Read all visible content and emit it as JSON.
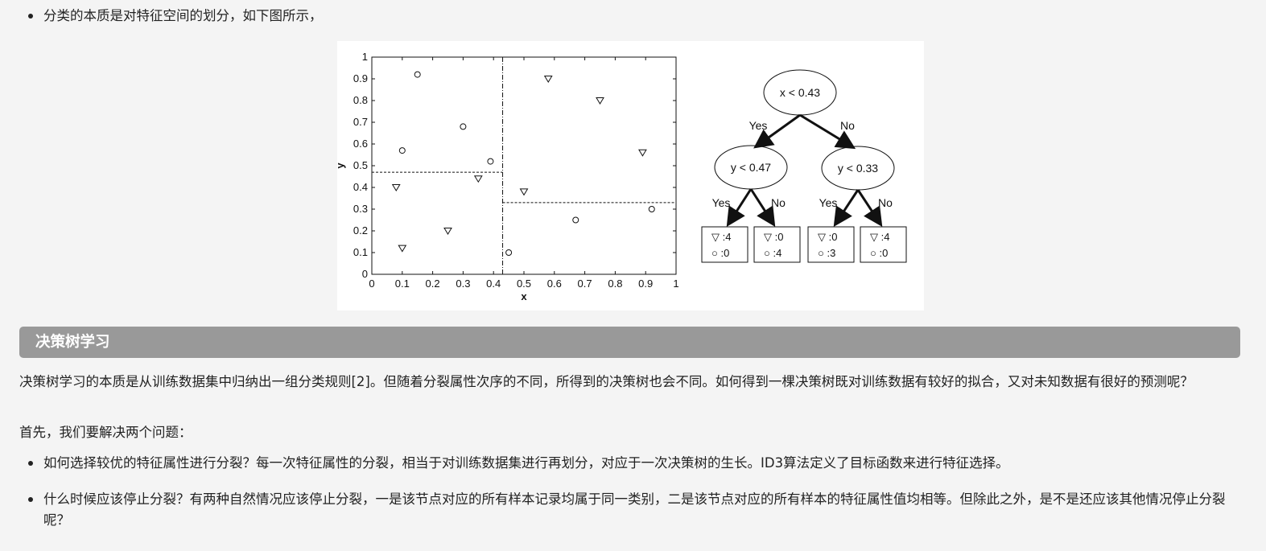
{
  "intro_bullet": "分类的本质是对特征空间的划分，如下图所示，",
  "figure": {
    "plot": {
      "xlabel": "x",
      "ylabel": "y",
      "x_ticks": [
        "0",
        "0.1",
        "0.2",
        "0.3",
        "0.4",
        "0.5",
        "0.6",
        "0.7",
        "0.8",
        "0.9",
        "1"
      ],
      "y_ticks": [
        "0",
        "0.1",
        "0.2",
        "0.3",
        "0.4",
        "0.5",
        "0.6",
        "0.7",
        "0.8",
        "0.9",
        "1"
      ]
    },
    "tree": {
      "root": {
        "label": "x < 0.43"
      },
      "left": {
        "label": "y < 0.47"
      },
      "right": {
        "label": "y < 0.33"
      },
      "yes": "Yes",
      "no": "No",
      "leaves": [
        {
          "tri": "▽ :4",
          "circ": "○ :0"
        },
        {
          "tri": "▽ :0",
          "circ": "○ :4"
        },
        {
          "tri": "▽ :0",
          "circ": "○ :3"
        },
        {
          "tri": "▽ :4",
          "circ": "○ :0"
        }
      ]
    }
  },
  "chart_data": {
    "type": "scatter",
    "xlabel": "x",
    "ylabel": "y",
    "xlim": [
      0,
      1
    ],
    "ylim": [
      0,
      1
    ],
    "series": [
      {
        "marker": "circle",
        "points": [
          [
            0.15,
            0.92
          ],
          [
            0.1,
            0.57
          ],
          [
            0.3,
            0.68
          ],
          [
            0.39,
            0.52
          ],
          [
            0.45,
            0.1
          ],
          [
            0.67,
            0.25
          ],
          [
            0.92,
            0.3
          ]
        ]
      },
      {
        "marker": "triangle-down",
        "points": [
          [
            0.08,
            0.4
          ],
          [
            0.1,
            0.12
          ],
          [
            0.25,
            0.2
          ],
          [
            0.35,
            0.44
          ],
          [
            0.5,
            0.38
          ],
          [
            0.58,
            0.9
          ],
          [
            0.75,
            0.8
          ],
          [
            0.89,
            0.56
          ]
        ]
      }
    ],
    "splits": [
      {
        "axis": "x",
        "value": 0.43,
        "range": [
          0,
          1
        ]
      },
      {
        "axis": "y",
        "value": 0.47,
        "range": [
          0,
          0.43
        ]
      },
      {
        "axis": "y",
        "value": 0.33,
        "range": [
          0.43,
          1
        ]
      }
    ]
  },
  "section_title": "决策树学习",
  "paragraph1": "决策树学习的本质是从训练数据集中归纳出一组分类规则[2]。但随着分裂属性次序的不同，所得到的决策树也会不同。如何得到一棵决策树既对训练数据有较好的拟合，又对未知数据有很好的预测呢？",
  "paragraph2": "首先，我们要解决两个问题：",
  "bullets": [
    "如何选择较优的特征属性进行分裂？每一次特征属性的分裂，相当于对训练数据集进行再划分，对应于一次决策树的生长。ID3算法定义了目标函数来进行特征选择。",
    "什么时候应该停止分裂？有两种自然情况应该停止分裂，一是该节点对应的所有样本记录均属于同一类别，二是该节点对应的所有样本的特征属性值均相等。但除此之外，是不是还应该其他情况停止分裂呢？"
  ]
}
